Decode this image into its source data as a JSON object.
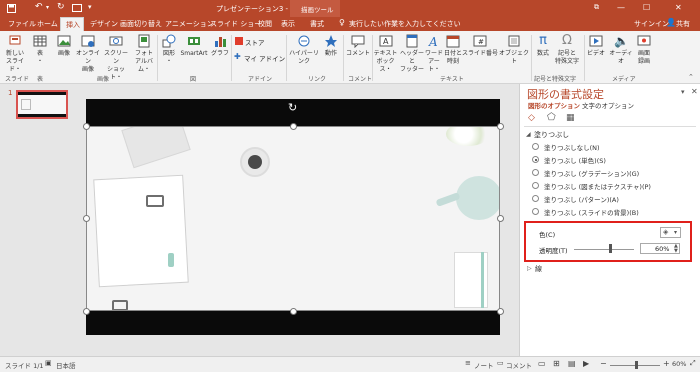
{
  "title_bar": {
    "doc_title": "プレゼンテーション3 - PowerPoint",
    "context_tab_group": "描画ツール",
    "window_buttons": [
      "—",
      "☐",
      "✕"
    ]
  },
  "tabs": {
    "items": [
      "ファイル",
      "ホーム",
      "挿入",
      "デザイン",
      "画面切り替え",
      "アニメーション",
      "スライド ショー",
      "校閲",
      "表示",
      "書式"
    ],
    "tell_me": "実行したい作業を入力してください",
    "signin": "サインイン",
    "share": "共有"
  },
  "ribbon": {
    "buttons": [
      {
        "label1": "新しい",
        "label2": "スライド・"
      },
      {
        "label1": "表",
        "label2": "・"
      },
      {
        "label1": "画像",
        "label2": ""
      },
      {
        "label1": "オンライン",
        "label2": "画像"
      },
      {
        "label1": "スクリーン",
        "label2": "ショット・"
      },
      {
        "label1": "フォト",
        "label2": "アルバム・"
      },
      {
        "label1": "図形",
        "label2": "・"
      },
      {
        "label1": "SmartArt",
        "label2": ""
      },
      {
        "label1": "グラフ",
        "label2": ""
      },
      {
        "label1": "ハイパーリンク",
        "label2": ""
      },
      {
        "label1": "動作",
        "label2": ""
      },
      {
        "label1": "コメント",
        "label2": ""
      },
      {
        "label1": "テキスト",
        "label2": "ボックス・"
      },
      {
        "label1": "ヘッダーと",
        "label2": "フッター"
      },
      {
        "label1": "ワード",
        "label2": "アート・"
      },
      {
        "label1": "日付と",
        "label2": "時刻"
      },
      {
        "label1": "スライド番号",
        "label2": ""
      },
      {
        "label1": "オブジェクト",
        "label2": ""
      },
      {
        "label1": "数式",
        "label2": ""
      },
      {
        "label1": "記号と",
        "label2": "特殊文字"
      },
      {
        "label1": "ビデオ",
        "label2": ""
      },
      {
        "label1": "オーディオ",
        "label2": ""
      },
      {
        "label1": "画面",
        "label2": "録画"
      }
    ],
    "store": "ストア",
    "my_addins": "マイ アドイン",
    "groups": [
      "スライド",
      "表",
      "画像",
      "図",
      "アドイン",
      "リンク",
      "コメント",
      "テキスト",
      "記号と特殊文字",
      "メディア"
    ]
  },
  "thumbnail": {
    "number": "1"
  },
  "format_pane": {
    "title": "図形の書式設定",
    "tab_shape": "図形のオプション",
    "tab_text": "文字のオプション",
    "fill_section": "塗りつぶし",
    "fill_options": [
      "塗りつぶしなし(N)",
      "塗りつぶし (単色)(S)",
      "塗りつぶし (グラデーション)(G)",
      "塗りつぶし (図またはテクスチャ)(P)",
      "塗りつぶし (パターン)(A)",
      "塗りつぶし (スライドの背景)(B)"
    ],
    "selected_fill": 1,
    "color_label": "色(C)",
    "transparency_label": "透明度(T)",
    "transparency_value": "60%",
    "transparency_fraction": 0.6,
    "line_section": "線"
  },
  "status_bar": {
    "slide_info": "スライド 1/1",
    "language": "日本語",
    "notes": "ノート",
    "comments": "コメント",
    "zoom": "60%"
  },
  "colors": {
    "accent": "#b7472a",
    "highlight_box": "#e0201b"
  }
}
